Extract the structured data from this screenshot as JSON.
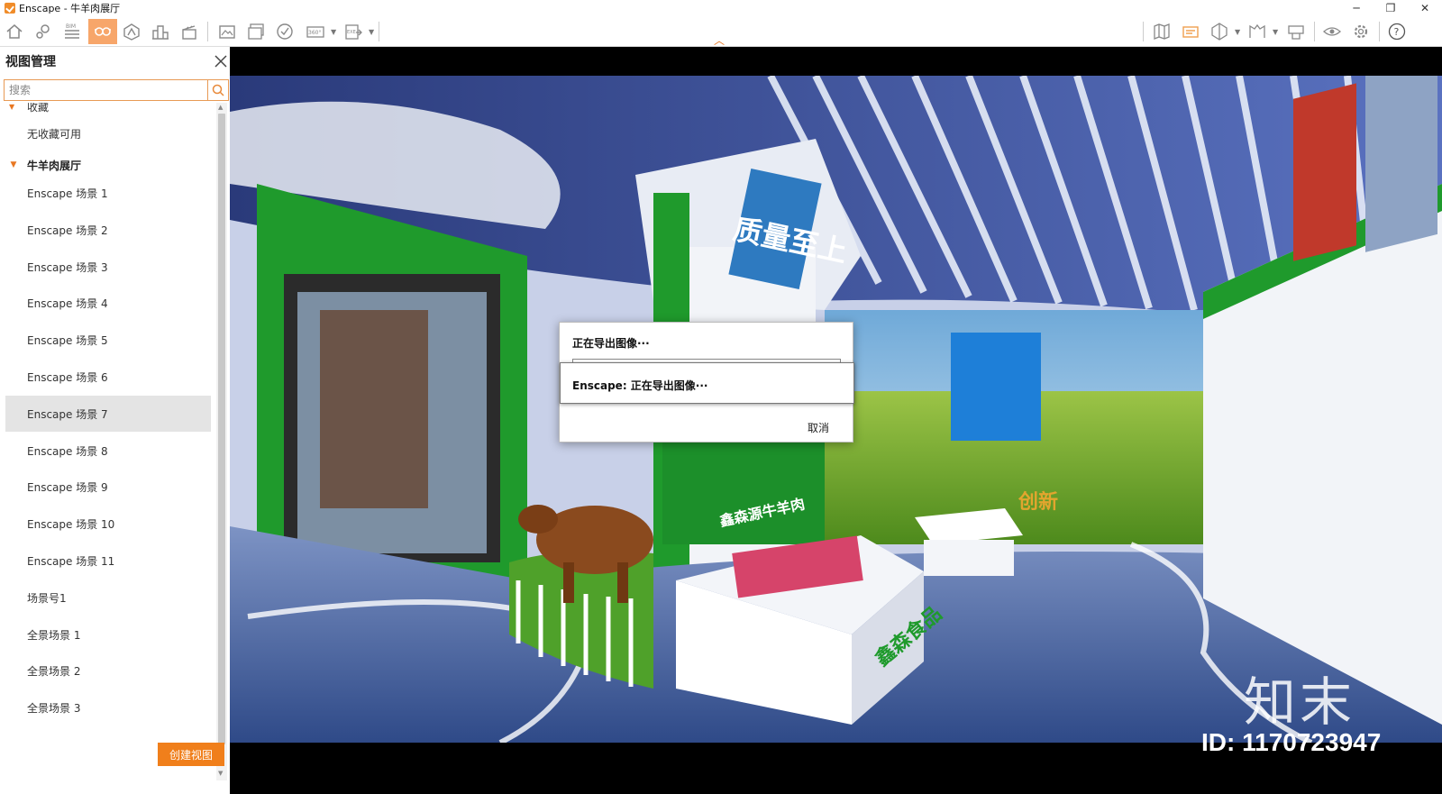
{
  "window": {
    "title": "Enscape - 牛羊肉展厅",
    "minimize_glyph": "─",
    "maximize_glyph": "❐",
    "close_glyph": "✕"
  },
  "toolbar": {
    "bim_label": "BIM",
    "pano_label": "360°",
    "exe_label": "EXE",
    "icons_left": [
      "home-icon",
      "location-pin-icon",
      "bim-icon",
      "view-management-icon",
      "asset-library-icon",
      "city-icon",
      "clapperboard-icon",
      "screenshot-icon",
      "batch-render-icon",
      "upload-icon",
      "panorama-360-icon",
      "export-exe-icon"
    ],
    "icons_right": [
      "map-icon",
      "sun-icon",
      "section-icon",
      "book-icon",
      "collab-icon",
      "visibility-icon",
      "settings-icon",
      "help-icon"
    ],
    "active": "view-management-icon"
  },
  "sidebar": {
    "title": "视图管理",
    "search_placeholder": "搜索",
    "favorites_partial": "收藏",
    "favorites_empty": "无收藏可用",
    "group_name": "牛羊肉展厅",
    "items": [
      {
        "label": "Enscape 场景 1"
      },
      {
        "label": "Enscape 场景 2"
      },
      {
        "label": "Enscape 场景 3"
      },
      {
        "label": "Enscape 场景 4"
      },
      {
        "label": "Enscape 场景 5"
      },
      {
        "label": "Enscape 场景 6"
      },
      {
        "label": "Enscape 场景 7"
      },
      {
        "label": "Enscape 场景 8"
      },
      {
        "label": "Enscape 场景 9"
      },
      {
        "label": "Enscape 场景 10"
      },
      {
        "label": "Enscape 场景 11"
      },
      {
        "label": "场景号1"
      },
      {
        "label": "全景场景 1"
      },
      {
        "label": "全景场景 2"
      },
      {
        "label": "全景场景 3"
      }
    ],
    "selected_item": "Enscape 场景 7",
    "create_button": "创建视图"
  },
  "viewport": {
    "scene_signs": {
      "quality": "质量至上",
      "innovation": "创新",
      "brand_left": "鑫森源牛羊肉",
      "brand_freezer": "鑫森食品"
    },
    "watermark_logo": "知末",
    "watermark_id": "ID: 1170723947"
  },
  "dialog": {
    "title": "正在导出图像···",
    "inner_message": "Enscape: 正在导出图像···",
    "cancel_label": "取消"
  },
  "colors": {
    "accent": "#f07f1b",
    "active_tool": "#f7a66a",
    "exhibit_green": "#1f9a2c",
    "floor_blue": "#4f6fa8"
  }
}
